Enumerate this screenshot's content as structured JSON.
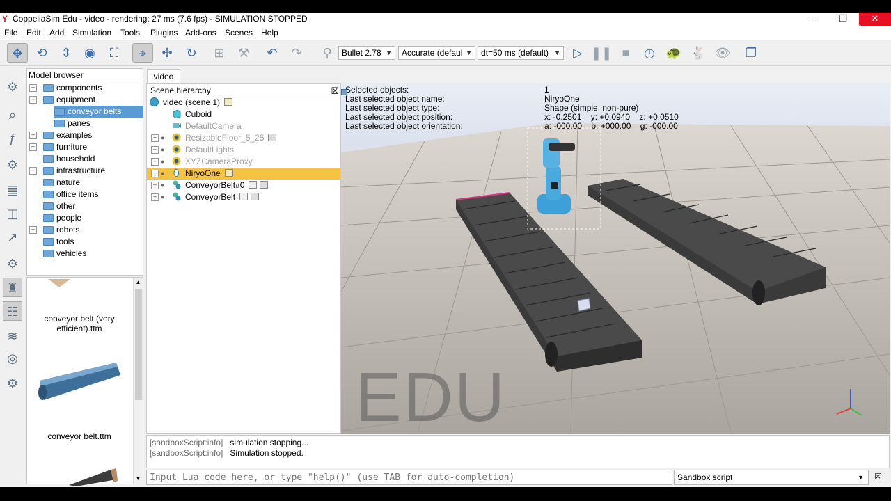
{
  "window": {
    "title": "CoppeliaSim Edu - video - rendering: 27 ms (7.6 fps) - SIMULATION STOPPED",
    "minimize": "—",
    "restore": "❐",
    "close": "✕"
  },
  "menu": [
    "File",
    "Edit",
    "Add",
    "Simulation",
    "Tools",
    "Plugins",
    "Add-ons",
    "Scenes",
    "Help"
  ],
  "toolbar": {
    "engine": "Bullet 2.78",
    "accuracy": "Accurate (defaul",
    "dt": "dt=50 ms (default)"
  },
  "model_browser": {
    "header": "Model browser",
    "items": [
      {
        "label": "components",
        "expander": "+"
      },
      {
        "label": "equipment",
        "expander": "−"
      },
      {
        "label": "conveyor belts",
        "expander": "",
        "selected": true
      },
      {
        "label": "panes",
        "expander": ""
      },
      {
        "label": "examples",
        "expander": "+"
      },
      {
        "label": "furniture",
        "expander": "+"
      },
      {
        "label": "household",
        "expander": ""
      },
      {
        "label": "infrastructure",
        "expander": "+"
      },
      {
        "label": "nature",
        "expander": ""
      },
      {
        "label": "office items",
        "expander": ""
      },
      {
        "label": "other",
        "expander": ""
      },
      {
        "label": "people",
        "expander": ""
      },
      {
        "label": "robots",
        "expander": "+"
      },
      {
        "label": "tools",
        "expander": ""
      },
      {
        "label": "vehicles",
        "expander": ""
      }
    ],
    "thumbnails": [
      "conveyor belt (very efficient).ttm",
      "conveyor belt.ttm"
    ]
  },
  "tabs": [
    "video"
  ],
  "scene_hierarchy": {
    "header": "Scene hierarchy",
    "items": [
      {
        "label": "video (scene 1)",
        "muted": false
      },
      {
        "label": "Cuboid",
        "muted": false
      },
      {
        "label": "DefaultCamera",
        "muted": true
      },
      {
        "label": "ResizableFloor_5_25",
        "muted": true
      },
      {
        "label": "DefaultLights",
        "muted": true
      },
      {
        "label": "XYZCameraProxy",
        "muted": true
      },
      {
        "label": "NiryoOne",
        "muted": false,
        "selected": true
      },
      {
        "label": "ConveyorBelt#0",
        "muted": false
      },
      {
        "label": "ConveyorBelt",
        "muted": false
      }
    ]
  },
  "selection_info": {
    "labels": [
      "Selected objects:",
      "Last selected object name:",
      "Last selected object type:",
      "Last selected object position:",
      "Last selected object orientation:"
    ],
    "values": [
      "1",
      "NiryoOne",
      "Shape (simple, non-pure)",
      "x: -0.2501    y: +0.0940    z: +0.0510",
      "a: -000.00    b: +000.00    g: -000.00"
    ]
  },
  "watermark": "EDU",
  "console": {
    "lines": [
      {
        "tag": "[sandboxScript:info]",
        "msg": "simulation stopping..."
      },
      {
        "tag": "[sandboxScript:info]",
        "msg": "Simulation stopped."
      }
    ],
    "placeholder": "Input Lua code here, or type \"help()\" (use TAB for auto-completion)",
    "script_selector": "Sandbox script"
  }
}
